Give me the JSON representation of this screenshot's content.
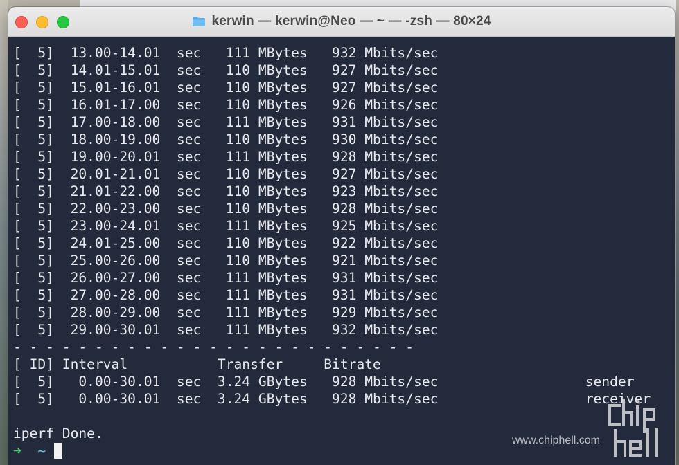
{
  "window": {
    "title": "kerwin — kerwin@Neo — ~ — -zsh — 80×24",
    "icon": "folder-icon"
  },
  "terminal": {
    "lines": [
      "[  5]  13.00-14.01  sec   111 MBytes   932 Mbits/sec",
      "[  5]  14.01-15.01  sec   110 MBytes   927 Mbits/sec",
      "[  5]  15.01-16.01  sec   110 MBytes   927 Mbits/sec",
      "[  5]  16.01-17.00  sec   110 MBytes   926 Mbits/sec",
      "[  5]  17.00-18.00  sec   111 MBytes   931 Mbits/sec",
      "[  5]  18.00-19.00  sec   110 MBytes   930 Mbits/sec",
      "[  5]  19.00-20.01  sec   111 MBytes   928 Mbits/sec",
      "[  5]  20.01-21.01  sec   110 MBytes   927 Mbits/sec",
      "[  5]  21.01-22.00  sec   110 MBytes   923 Mbits/sec",
      "[  5]  22.00-23.00  sec   110 MBytes   928 Mbits/sec",
      "[  5]  23.00-24.01  sec   111 MBytes   925 Mbits/sec",
      "[  5]  24.01-25.00  sec   110 MBytes   922 Mbits/sec",
      "[  5]  25.00-26.00  sec   110 MBytes   921 Mbits/sec",
      "[  5]  26.00-27.00  sec   111 MBytes   931 Mbits/sec",
      "[  5]  27.00-28.00  sec   111 MBytes   931 Mbits/sec",
      "[  5]  28.00-29.00  sec   111 MBytes   929 Mbits/sec",
      "[  5]  29.00-30.01  sec   111 MBytes   932 Mbits/sec",
      "- - - - - - - - - - - - - - - - - - - - - - - - -",
      "[ ID] Interval           Transfer     Bitrate",
      "[  5]   0.00-30.01  sec  3.24 GBytes   928 Mbits/sec                  sender",
      "[  5]   0.00-30.01  sec  3.24 GBytes   928 Mbits/sec                  receiver",
      "",
      "iperf Done."
    ],
    "prompt_arrow": "➜",
    "prompt_dir": "~"
  },
  "watermark": {
    "url": "www.chiphell.com",
    "logo": "chiphell-logo"
  },
  "colors": {
    "terminal_bg": "#232a3b",
    "terminal_fg": "#e8e9ee",
    "prompt_arrow": "#4ec96b",
    "prompt_dir": "#5ec7d6"
  }
}
